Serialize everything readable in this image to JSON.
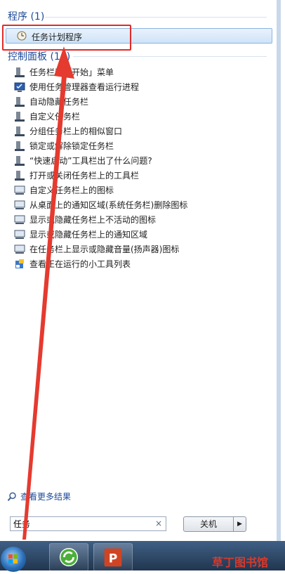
{
  "programs": {
    "header": "程序 (1)",
    "items": [
      {
        "label": "任务计划程序",
        "icon": "clock-icon"
      }
    ]
  },
  "control_panel": {
    "header": "控制面板 (14)",
    "items": [
      {
        "label": "任务栏和「开始」菜单",
        "icon": "taskbar-icon"
      },
      {
        "label": "使用任务管理器查看运行进程",
        "icon": "monitor-check-icon"
      },
      {
        "label": "自动隐藏任务栏",
        "icon": "taskbar-icon"
      },
      {
        "label": "自定义任务栏",
        "icon": "taskbar-icon"
      },
      {
        "label": "分组任务栏上的相似窗口",
        "icon": "taskbar-icon"
      },
      {
        "label": "锁定或解除锁定任务栏",
        "icon": "taskbar-icon"
      },
      {
        "label": "“快速启动”工具栏出了什么问题?",
        "icon": "taskbar-icon"
      },
      {
        "label": "打开或关闭任务栏上的工具栏",
        "icon": "taskbar-icon"
      },
      {
        "label": "自定义任务栏上的图标",
        "icon": "monitor-icon"
      },
      {
        "label": "从桌面上的通知区域(系统任务栏)删除图标",
        "icon": "monitor-icon"
      },
      {
        "label": "显示或隐藏任务栏上不活动的图标",
        "icon": "monitor-icon"
      },
      {
        "label": "显示或隐藏任务栏上的通知区域",
        "icon": "monitor-icon"
      },
      {
        "label": "在任务栏上显示或隐藏音量(扬声器)图标",
        "icon": "monitor-icon"
      },
      {
        "label": "查看正在运行的小工具列表",
        "icon": "gadget-icon"
      }
    ]
  },
  "more_results": "查看更多结果",
  "search": {
    "value": "任务",
    "clear": "×"
  },
  "shutdown": {
    "label": "关机",
    "arrow": "▶"
  },
  "watermark": "草丁图书馆",
  "colors": {
    "accent": "#1e4a99",
    "highlight": "#e02a2a",
    "taskbar": "#2c4566"
  }
}
